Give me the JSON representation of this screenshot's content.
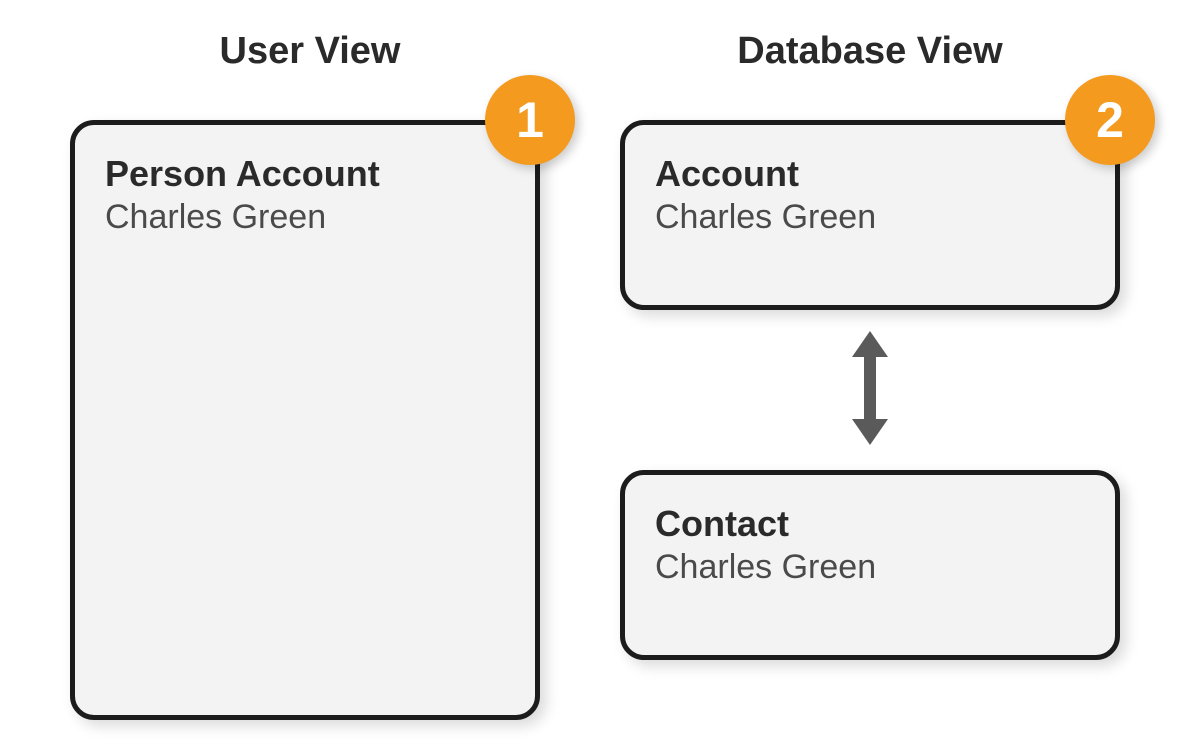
{
  "columns": {
    "left": {
      "title": "User View",
      "badge": "1",
      "card": {
        "title": "Person Account",
        "name": "Charles Green"
      }
    },
    "right": {
      "title": "Database View",
      "badge": "2",
      "cards": {
        "account": {
          "title": "Account",
          "name": "Charles Green"
        },
        "contact": {
          "title": "Contact",
          "name": "Charles Green"
        }
      }
    }
  },
  "colors": {
    "badge_bg": "#f39a1f",
    "card_bg": "#f3f3f3",
    "border": "#1c1c1c",
    "text_dark": "#2a2a2a",
    "text_medium": "#4a4a4a",
    "arrow": "#5a5a5a"
  }
}
